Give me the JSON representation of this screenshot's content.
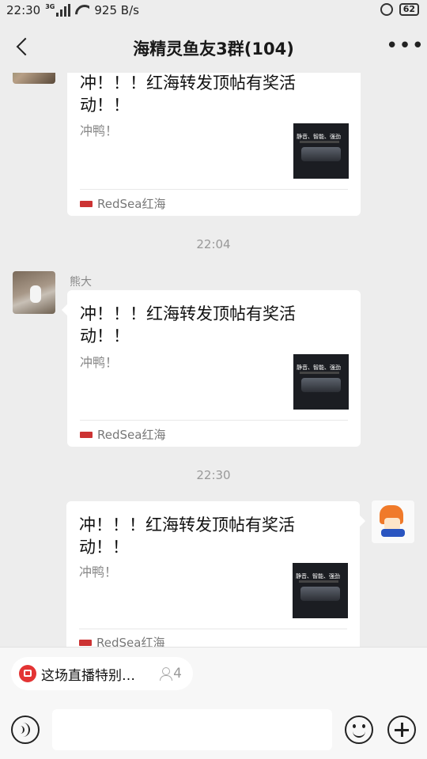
{
  "status_bar": {
    "time": "22:30",
    "network": "3G",
    "speed": "925 B/s",
    "battery": "62"
  },
  "nav": {
    "title": "海精灵鱼友3群(104)"
  },
  "messages": [
    {
      "card_title": "冲！！！红海转发顶帖有奖活动！！",
      "card_desc": "冲鸭！",
      "thumb_text": "静音、智能、强劲",
      "source": "RedSea红海"
    },
    {
      "time": "22:04",
      "sender": "熊大",
      "card_title": "冲！！！红海转发顶帖有奖活动！！",
      "card_desc": "冲鸭！",
      "thumb_text": "静音、智能、强劲",
      "source": "RedSea红海"
    },
    {
      "time": "22:30",
      "card_title": "冲！！！红海转发顶帖有奖活动！！",
      "card_desc": "冲鸭！",
      "thumb_text": "静音、智能、强劲",
      "source": "RedSea红海"
    }
  ],
  "live_bar": {
    "text": "这场直播特别…",
    "viewers": "4"
  },
  "colors": {
    "background": "#ededed",
    "card": "#ffffff",
    "live_icon": "#e33434"
  }
}
